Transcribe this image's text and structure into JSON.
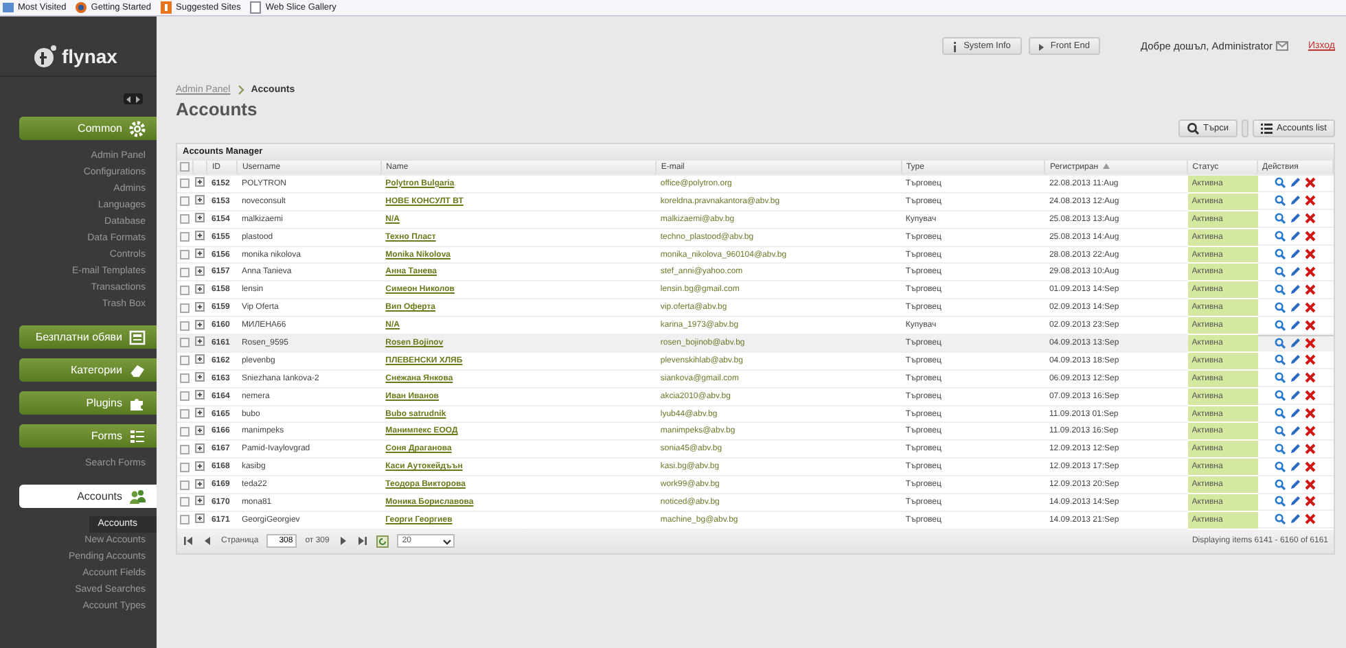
{
  "bookmarks_bar": {
    "items": [
      {
        "label": "Most Visited"
      },
      {
        "label": "Getting Started"
      },
      {
        "label": "Suggested Sites"
      },
      {
        "label": "Web Slice Gallery"
      }
    ]
  },
  "sidebar": {
    "logo": "flynax",
    "collapsed": false,
    "sections": [
      {
        "label": "Common",
        "selected": false,
        "items": [
          {
            "label": "Admin Panel",
            "selected": false
          },
          {
            "label": "Configurations",
            "selected": false
          },
          {
            "label": "Admins",
            "selected": false
          },
          {
            "label": "Languages",
            "selected": false
          },
          {
            "label": "Database",
            "selected": false
          },
          {
            "label": "Data Formats",
            "selected": false
          },
          {
            "label": "Controls",
            "selected": false
          },
          {
            "label": "E-mail Templates",
            "selected": false
          },
          {
            "label": "Transactions",
            "selected": false
          },
          {
            "label": "Trash Box",
            "selected": false
          }
        ]
      },
      {
        "label": "Безплатни обяви",
        "selected": false
      },
      {
        "label": "Категории",
        "selected": false
      },
      {
        "label": "Plugins",
        "selected": false
      },
      {
        "label": "Forms",
        "selected": false,
        "items": [
          {
            "label": "Search Forms",
            "selected": false
          }
        ]
      },
      {
        "label": "Accounts",
        "selected": true,
        "items": [
          {
            "label": "Accounts",
            "selected": true
          },
          {
            "label": "New Accounts",
            "selected": false
          },
          {
            "label": "Pending Accounts",
            "selected": false
          },
          {
            "label": "Account Fields",
            "selected": false
          },
          {
            "label": "Saved Searches",
            "selected": false
          },
          {
            "label": "Account Types",
            "selected": false
          }
        ]
      }
    ]
  },
  "top_bar": {
    "buttons": [
      {
        "label": "System Info"
      },
      {
        "label": "Front End"
      }
    ],
    "greeting": "Добре дошъл, Administrator",
    "logout": "Изход"
  },
  "breadcrumb": [
    "Admin Panel",
    "Accounts"
  ],
  "page_title": "Accounts",
  "toolbar": {
    "buttons": [
      {
        "label": "Търси"
      },
      {
        "label": "Accounts list"
      }
    ]
  },
  "table": {
    "title": "Accounts Manager",
    "all_checked": false,
    "columns": [
      {
        "label": "ID",
        "sorted": false
      },
      {
        "label": "Username",
        "sorted": false
      },
      {
        "label": "Name",
        "sorted": false
      },
      {
        "label": "E-mail",
        "sorted": false
      },
      {
        "label": "Type",
        "sorted": false
      },
      {
        "label": "Регистриран",
        "sorted": true
      },
      {
        "label": "Статус",
        "sorted": false
      },
      {
        "label": "Действия",
        "sorted": false
      }
    ],
    "rows": [
      {
        "id": "6152",
        "username": "POLYTRON",
        "name": "Polytron Bulgaria",
        "email": "office@polytron.org",
        "type": "Търговец",
        "registered": "22.08.2013 11:Aug",
        "status": "Активна",
        "selected": false
      },
      {
        "id": "6153",
        "username": "noveconsult",
        "name": "НОВЕ КОНСУЛТ ВТ",
        "email": "koreldna.pravnakantora@abv.bg",
        "type": "Търговец",
        "registered": "24.08.2013 12:Aug",
        "status": "Активна",
        "selected": false
      },
      {
        "id": "6154",
        "username": "malkizaemi",
        "name": "N/A",
        "email": "malkizaemi@abv.bg",
        "type": "Купувач",
        "registered": "25.08.2013 13:Aug",
        "status": "Активна",
        "selected": false
      },
      {
        "id": "6155",
        "username": "plastood",
        "name": "Техно Пласт",
        "email": "techno_plastood@abv.bg",
        "type": "Търговец",
        "registered": "25.08.2013 14:Aug",
        "status": "Активна",
        "selected": false
      },
      {
        "id": "6156",
        "username": "monika nikolova",
        "name": "Monika Nikolova",
        "email": "monika_nikolova_960104@abv.bg",
        "type": "Търговец",
        "registered": "28.08.2013 22:Aug",
        "status": "Активна",
        "selected": false
      },
      {
        "id": "6157",
        "username": "Anna Tanieva",
        "name": "Анна Танева",
        "email": "stef_anni@yahoo.com",
        "type": "Търговец",
        "registered": "29.08.2013 10:Aug",
        "status": "Активна",
        "selected": false
      },
      {
        "id": "6158",
        "username": "lensin",
        "name": "Симеон Николов",
        "email": "lensin.bg@gmail.com",
        "type": "Търговец",
        "registered": "01.09.2013 14:Sep",
        "status": "Активна",
        "selected": false
      },
      {
        "id": "6159",
        "username": "Vip Oferta",
        "name": "Вип Оферта",
        "email": "vip.oferta@abv.bg",
        "type": "Търговец",
        "registered": "02.09.2013 14:Sep",
        "status": "Активна",
        "selected": false
      },
      {
        "id": "6160",
        "username": "МИЛЕНА66",
        "name": "N/A",
        "email": "karina_1973@abv.bg",
        "type": "Купувач",
        "registered": "02.09.2013 23:Sep",
        "status": "Активна",
        "selected": false
      },
      {
        "id": "6161",
        "username": "Rosen_9595",
        "name": "Rosen Bojinov",
        "email": "rosen_bojinob@abv.bg",
        "type": "Търговец",
        "registered": "04.09.2013 13:Sep",
        "status": "Активна",
        "selected": true
      },
      {
        "id": "6162",
        "username": "plevenbg",
        "name": "ПЛЕВЕНСКИ ХЛЯБ",
        "email": "plevenskihlab@abv.bg",
        "type": "Търговец",
        "registered": "04.09.2013 18:Sep",
        "status": "Активна",
        "selected": false
      },
      {
        "id": "6163",
        "username": "Sniezhana Iankova-2",
        "name": "Снежана Янкова",
        "email": "siankova@gmail.com",
        "type": "Търговец",
        "registered": "06.09.2013 12:Sep",
        "status": "Активна",
        "selected": false
      },
      {
        "id": "6164",
        "username": "nemera",
        "name": "Иван Иванов",
        "email": "akcia2010@abv.bg",
        "type": "Търговец",
        "registered": "07.09.2013 16:Sep",
        "status": "Активна",
        "selected": false
      },
      {
        "id": "6165",
        "username": "bubo",
        "name": "Bubo satrudnik",
        "email": "lyub44@abv.bg",
        "type": "Търговец",
        "registered": "11.09.2013 01:Sep",
        "status": "Активна",
        "selected": false
      },
      {
        "id": "6166",
        "username": "manimpeks",
        "name": "Манимпекс ЕООД",
        "email": "manimpeks@abv.bg",
        "type": "Търговец",
        "registered": "11.09.2013 16:Sep",
        "status": "Активна",
        "selected": false
      },
      {
        "id": "6167",
        "username": "Pamid-Ivaylovgrad",
        "name": "Соня Драганова",
        "email": "sonia45@abv.bg",
        "type": "Търговец",
        "registered": "12.09.2013 12:Sep",
        "status": "Активна",
        "selected": false
      },
      {
        "id": "6168",
        "username": "kasibg",
        "name": "Каси Аутокейдъън",
        "email": "kasi.bg@abv.bg",
        "type": "Търговец",
        "registered": "12.09.2013 17:Sep",
        "status": "Активна",
        "selected": false
      },
      {
        "id": "6169",
        "username": "teda22",
        "name": "Теодора Викторова",
        "email": "work99@abv.bg",
        "type": "Търговец",
        "registered": "12.09.2013 20:Sep",
        "status": "Активна",
        "selected": false
      },
      {
        "id": "6170",
        "username": "mona81",
        "name": "Моника Бориславова",
        "email": "noticed@abv.bg",
        "type": "Търговец",
        "registered": "14.09.2013 14:Sep",
        "status": "Активна",
        "selected": false
      },
      {
        "id": "6171",
        "username": "GeorgiGeorgiev",
        "name": "Георги Георгиев",
        "email": "machine_bg@abv.bg",
        "type": "Търговец",
        "registered": "14.09.2013 21:Sep",
        "status": "Активна",
        "selected": false
      }
    ]
  },
  "pager": {
    "page_label": "Страница",
    "page": "308",
    "of": "от 309",
    "per_page": "20",
    "summary": "Displaying items 6141 - 6160 of 6161"
  }
}
